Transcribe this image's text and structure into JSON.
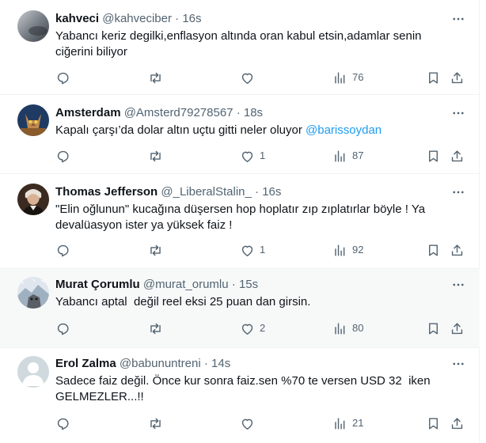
{
  "tweets": [
    {
      "name": "kahveci",
      "handle": "@kahveciber",
      "sep": "·",
      "time": "16s",
      "lines": [
        "Yabancı keriz degilki,enflasyon altında oran kabul etsin,adamlar senin",
        "ciğerini biliyor"
      ],
      "likes": "",
      "views": "76",
      "highlighted": false
    },
    {
      "name": "Amsterdam",
      "handle": "@Amsterd79278567",
      "sep": "·",
      "time": "18s",
      "text_pre": "Kapalı çarşı’da dolar altın uçtu gitti neler oluyor ",
      "mention": "@barissoydan",
      "likes": "1",
      "views": "87",
      "highlighted": false
    },
    {
      "name": "Thomas Jefferson",
      "handle": "@_LiberalStalin_",
      "sep": "·",
      "time": "16s",
      "lines": [
        "\"Elin oğlunun\" kucağına düşersen hop hoplatır zıp zıplatırlar böyle ! Ya",
        "devalüasyon ister ya yüksek faiz !"
      ],
      "likes": "1",
      "views": "92",
      "highlighted": false
    },
    {
      "name": "Murat Çorumlu",
      "handle": "@murat_orumlu",
      "sep": "·",
      "time": "15s",
      "lines": [
        "Yabancı aptal  değil reel eksi 25 puan dan girsin."
      ],
      "likes": "2",
      "views": "80",
      "highlighted": true
    },
    {
      "name": "Erol Zalma",
      "handle": "@babununtreni",
      "sep": "·",
      "time": "14s",
      "lines": [
        "Sadece faiz değil. Önce kur sonra faiz.sen %70 te versen USD 32  iken",
        "GELMEZLER...!!"
      ],
      "likes": "",
      "views": "21",
      "highlighted": false
    }
  ],
  "colors": {
    "text": "#0f1419",
    "secondary": "#536471",
    "link": "#1d9bf0",
    "divider": "#eff3f4",
    "highlight_bg": "#f7f9f9"
  },
  "icons": [
    "more-icon",
    "reply-icon",
    "retweet-icon",
    "like-icon",
    "views-icon",
    "bookmark-icon",
    "share-icon"
  ]
}
